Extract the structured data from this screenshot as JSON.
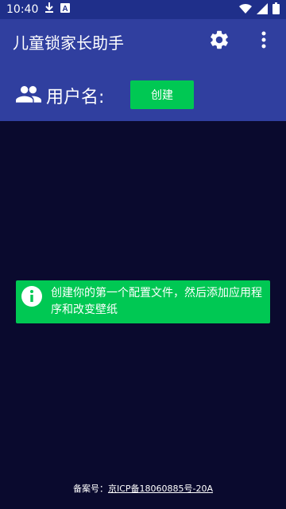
{
  "status_bar": {
    "time": "10:40",
    "icons": [
      "download-icon",
      "a-badge-icon",
      "wifi-icon",
      "signal-icon",
      "battery-icon"
    ]
  },
  "app_bar": {
    "title": "儿童锁家长助手",
    "icons": [
      "gear-icon",
      "more-vert-icon"
    ],
    "username_label": "用户名:",
    "create_label": "创建",
    "colors": {
      "app_bar": "#303f9f",
      "status_bar": "#1f2f8a",
      "accent": "#00c853"
    }
  },
  "main": {
    "banner_text": "创建你的第一个配置文件，然后添加应用程序和改变壁纸",
    "background": "#0a0a2e"
  },
  "footer": {
    "prefix": "备案号：",
    "icp": "京ICP备18060885号-20A"
  }
}
